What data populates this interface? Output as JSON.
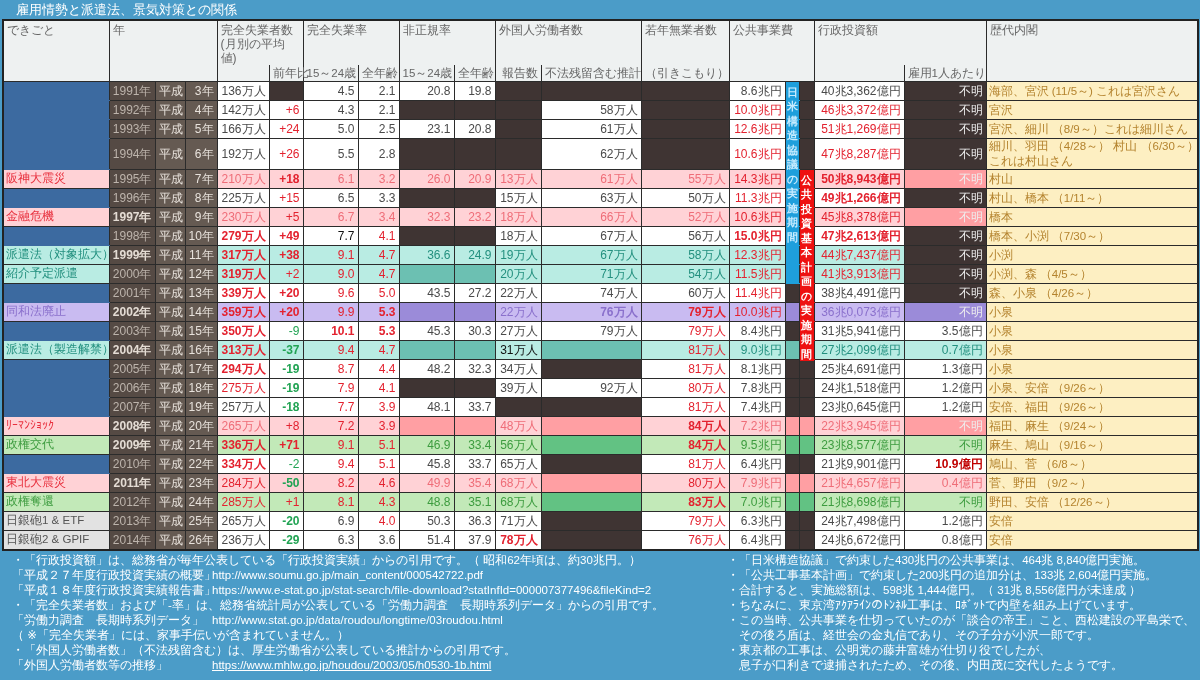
{
  "title": "雇用情勢と派遣法、景気対策との関係",
  "header": [
    {
      "title": "できごと"
    },
    {
      "title": "年"
    },
    {
      "title": "完全失業者数 (月別の平均値)",
      "subs": [
        "前年比"
      ]
    },
    {
      "title": "完全失業率",
      "subs": [
        "15～24歳",
        "全年齢"
      ]
    },
    {
      "title": "非正規率",
      "subs": [
        "15～24歳",
        "全年齢"
      ]
    },
    {
      "title": "外国人労働者数",
      "subs": [
        "報告数",
        "不法残留含む推計"
      ]
    },
    {
      "title": "若年無業者数",
      "subs": [
        "（引きこもり）"
      ]
    },
    {
      "title": "公共事業費"
    },
    {
      "title": "行政投資額",
      "subs": [
        "雇用1人あたり"
      ]
    },
    {
      "title": "歴代内閣"
    }
  ],
  "period_bars": [
    {
      "label": "日米構造協議の実施期間",
      "color": "#1e9fdc"
    },
    {
      "label": "公共投資基本計画の実施期間",
      "color": "#ee1111"
    }
  ],
  "rows": [
    {
      "year": "1991年",
      "era": "平成",
      "era_year": "3年",
      "highlight": false,
      "kind": "white",
      "periods": [
        true,
        false
      ],
      "cells": [
        {
          "text": "136万人",
          "kind": "plain"
        },
        {
          "kind": "dark"
        },
        {
          "text": "4.5",
          "kind": "plain"
        },
        {
          "text": "2.1",
          "kind": "plain"
        },
        {
          "text": "20.8",
          "kind": "plain"
        },
        {
          "text": "19.8",
          "kind": "plain"
        },
        {
          "kind": "dark"
        },
        {
          "kind": "dark"
        },
        {
          "kind": "dark"
        },
        {
          "text": "8.6兆円",
          "kind": "plain"
        },
        {
          "text": "40兆3,362億円",
          "kind": "plain"
        },
        {
          "text": "不明",
          "kind": "light-dark"
        }
      ],
      "cabinet": [
        "海部、宮沢 (11/5～) これは宮沢さん"
      ]
    },
    {
      "year": "1992年",
      "era": "平成",
      "era_year": "4年",
      "highlight": false,
      "kind": "white",
      "periods": [
        true,
        false
      ],
      "cells": [
        {
          "text": "142万人",
          "kind": "plain"
        },
        {
          "text": "+6",
          "kind": "red"
        },
        {
          "text": "4.3",
          "kind": "plain"
        },
        {
          "text": "2.1",
          "kind": "plain"
        },
        {
          "kind": "dark"
        },
        {
          "kind": "dark"
        },
        {
          "kind": "dark"
        },
        {
          "text": "58万人",
          "kind": "plain"
        },
        {
          "kind": "dark"
        },
        {
          "text": "10.0兆円",
          "kind": "red"
        },
        {
          "text": "46兆3,372億円",
          "kind": "red"
        },
        {
          "text": "不明",
          "kind": "light-dark"
        }
      ],
      "cabinet": [
        "宮沢"
      ]
    },
    {
      "year": "1993年",
      "era": "平成",
      "era_year": "5年",
      "highlight": false,
      "kind": "white",
      "periods": [
        true,
        false
      ],
      "cells": [
        {
          "text": "166万人",
          "kind": "plain"
        },
        {
          "text": "+24",
          "kind": "red"
        },
        {
          "text": "5.0",
          "kind": "plain"
        },
        {
          "text": "2.5",
          "kind": "plain"
        },
        {
          "text": "23.1",
          "kind": "plain"
        },
        {
          "text": "20.8",
          "kind": "plain"
        },
        {
          "kind": "dark"
        },
        {
          "text": "61万人",
          "kind": "plain"
        },
        {
          "kind": "dark"
        },
        {
          "text": "12.6兆円",
          "kind": "red"
        },
        {
          "text": "51兆1,269億円",
          "kind": "red"
        },
        {
          "text": "不明",
          "kind": "light-dark"
        }
      ],
      "cabinet": [
        "宮沢、細川 （8/9～）これは細川さん"
      ]
    },
    {
      "year": "1994年",
      "era": "平成",
      "era_year": "6年",
      "highlight": false,
      "kind": "white",
      "periods": [
        true,
        false
      ],
      "cells": [
        {
          "text": "192万人",
          "kind": "plain"
        },
        {
          "text": "+26",
          "kind": "red"
        },
        {
          "text": "5.5",
          "kind": "plain"
        },
        {
          "text": "2.8",
          "kind": "plain"
        },
        {
          "kind": "dark"
        },
        {
          "kind": "dark"
        },
        {
          "kind": "dark"
        },
        {
          "text": "62万人",
          "kind": "plain"
        },
        {
          "kind": "dark"
        },
        {
          "text": "10.6兆円",
          "kind": "red"
        },
        {
          "text": "47兆8,287億円",
          "kind": "red"
        },
        {
          "text": "不明",
          "kind": "light-dark"
        }
      ],
      "cabinet": [
        "細川、羽田 （4/28～） 村山 （6/30～）",
        "これは村山さん"
      ]
    },
    {
      "event": {
        "text": "阪神大震災",
        "kind": "pink"
      },
      "year": "1995年",
      "era": "平成",
      "era_year": "7年",
      "highlight": false,
      "kind": "pink",
      "periods": [
        true,
        true
      ],
      "cells": [
        {
          "text": "210万人",
          "kind": "plain"
        },
        {
          "text": "+18",
          "kind": "redb"
        },
        {
          "text": "6.1",
          "kind": "plain"
        },
        {
          "text": "3.2",
          "kind": "plain"
        },
        {
          "text": "26.0",
          "kind": "plain"
        },
        {
          "text": "20.9",
          "kind": "plain"
        },
        {
          "text": "13万人",
          "kind": "plain"
        },
        {
          "text": "61万人",
          "kind": "plain"
        },
        {
          "text": "55万人",
          "kind": "plain"
        },
        {
          "text": "14.3兆円",
          "kind": "red"
        },
        {
          "text": "50兆8,943億円",
          "kind": "redb"
        },
        {
          "text": "不明",
          "kind": "light-deep"
        }
      ],
      "cabinet": [
        "村山"
      ]
    },
    {
      "year": "1996年",
      "era": "平成",
      "era_year": "8年",
      "highlight": false,
      "kind": "white",
      "periods": [
        true,
        true
      ],
      "cells": [
        {
          "text": "225万人",
          "kind": "plain"
        },
        {
          "text": "+15",
          "kind": "red"
        },
        {
          "text": "6.5",
          "kind": "plain"
        },
        {
          "text": "3.3",
          "kind": "plain"
        },
        {
          "kind": "dark"
        },
        {
          "kind": "dark"
        },
        {
          "text": "15万人",
          "kind": "plain"
        },
        {
          "text": "63万人",
          "kind": "plain"
        },
        {
          "text": "50万人",
          "kind": "plain"
        },
        {
          "text": "11.3兆円",
          "kind": "red"
        },
        {
          "text": "49兆1,266億円",
          "kind": "redb"
        },
        {
          "text": "不明",
          "kind": "light-dark"
        }
      ],
      "cabinet": [
        "村山、橋本 （1/11～）"
      ]
    },
    {
      "event": {
        "text": "金融危機",
        "kind": "pink"
      },
      "year": "1997年",
      "era": "平成",
      "era_year": "9年",
      "highlight": true,
      "kind": "pink",
      "periods": [
        true,
        true
      ],
      "cells": [
        {
          "text": "230万人",
          "kind": "plain"
        },
        {
          "text": "+5",
          "kind": "red"
        },
        {
          "text": "6.7",
          "kind": "plain"
        },
        {
          "text": "3.4",
          "kind": "plain"
        },
        {
          "text": "32.3",
          "kind": "plain"
        },
        {
          "text": "23.2",
          "kind": "plain"
        },
        {
          "text": "18万人",
          "kind": "plain"
        },
        {
          "text": "66万人",
          "kind": "plain"
        },
        {
          "text": "52万人",
          "kind": "plain"
        },
        {
          "text": "10.6兆円",
          "kind": "red"
        },
        {
          "text": "45兆8,378億円",
          "kind": "red"
        },
        {
          "text": "不明",
          "kind": "light-deep"
        }
      ],
      "cabinet": [
        "橋本"
      ]
    },
    {
      "year": "1998年",
      "era": "平成",
      "era_year": "10年",
      "highlight": false,
      "kind": "white",
      "periods": [
        true,
        true
      ],
      "cells": [
        {
          "text": "279万人",
          "kind": "redb"
        },
        {
          "text": "+49",
          "kind": "redb"
        },
        {
          "text": "7.7",
          "kind": "black"
        },
        {
          "text": "4.1",
          "kind": "red"
        },
        {
          "kind": "dark"
        },
        {
          "kind": "dark"
        },
        {
          "text": "18万人",
          "kind": "plain"
        },
        {
          "text": "67万人",
          "kind": "plain"
        },
        {
          "text": "56万人",
          "kind": "plain"
        },
        {
          "text": "15.0兆円",
          "kind": "redb"
        },
        {
          "text": "47兆2,613億円",
          "kind": "redb"
        },
        {
          "text": "不明",
          "kind": "light-dark"
        }
      ],
      "cabinet": [
        "橋本、小渕 （7/30～）"
      ]
    },
    {
      "event": {
        "text": "派遣法（対象拡大）",
        "kind": "teal"
      },
      "year": "1999年",
      "era": "平成",
      "era_year": "11年",
      "highlight": true,
      "kind": "teal",
      "periods": [
        true,
        true
      ],
      "cells": [
        {
          "text": "317万人",
          "kind": "redb"
        },
        {
          "text": "+38",
          "kind": "redb"
        },
        {
          "text": "9.1",
          "kind": "red"
        },
        {
          "text": "4.7",
          "kind": "red"
        },
        {
          "text": "36.6",
          "kind": "plain"
        },
        {
          "text": "24.9",
          "kind": "plain"
        },
        {
          "text": "19万人",
          "kind": "plain"
        },
        {
          "text": "67万人",
          "kind": "plain"
        },
        {
          "text": "58万人",
          "kind": "plain"
        },
        {
          "text": "12.3兆円",
          "kind": "red"
        },
        {
          "text": "44兆7,437億円",
          "kind": "red"
        },
        {
          "text": "不明",
          "kind": "light-dark"
        }
      ],
      "cabinet": [
        "小渕"
      ]
    },
    {
      "event": {
        "text": "紹介予定派遣",
        "kind": "teal"
      },
      "year": "2000年",
      "era": "平成",
      "era_year": "12年",
      "highlight": false,
      "kind": "teal",
      "periods": [
        true,
        true
      ],
      "cells": [
        {
          "text": "319万人",
          "kind": "redb"
        },
        {
          "text": "+2",
          "kind": "red"
        },
        {
          "text": "9.0",
          "kind": "red"
        },
        {
          "text": "4.7",
          "kind": "red"
        },
        {
          "kind": "deep"
        },
        {
          "kind": "deep"
        },
        {
          "text": "20万人",
          "kind": "plain"
        },
        {
          "text": "71万人",
          "kind": "plain"
        },
        {
          "text": "54万人",
          "kind": "plain"
        },
        {
          "text": "11.5兆円",
          "kind": "red"
        },
        {
          "text": "41兆3,913億円",
          "kind": "red"
        },
        {
          "text": "不明",
          "kind": "light-dark"
        }
      ],
      "cabinet": [
        "小渕、森 （4/5～）"
      ]
    },
    {
      "year": "2001年",
      "era": "平成",
      "era_year": "13年",
      "highlight": false,
      "kind": "white",
      "periods": [
        false,
        true
      ],
      "cells": [
        {
          "text": "339万人",
          "kind": "redb"
        },
        {
          "text": "+20",
          "kind": "redb"
        },
        {
          "text": "9.6",
          "kind": "red"
        },
        {
          "text": "5.0",
          "kind": "red"
        },
        {
          "text": "43.5",
          "kind": "plain"
        },
        {
          "text": "27.2",
          "kind": "plain"
        },
        {
          "text": "22万人",
          "kind": "plain"
        },
        {
          "text": "74万人",
          "kind": "plain"
        },
        {
          "text": "60万人",
          "kind": "plain"
        },
        {
          "text": "11.4兆円",
          "kind": "red"
        },
        {
          "text": "38兆4,491億円",
          "kind": "plain"
        },
        {
          "text": "不明",
          "kind": "light-dark"
        }
      ],
      "cabinet": [
        "森、小泉 （4/26～）"
      ]
    },
    {
      "event": {
        "text": "同和法廃止",
        "kind": "purple"
      },
      "year": "2002年",
      "era": "平成",
      "era_year": "14年",
      "highlight": true,
      "kind": "purple",
      "periods": [
        false,
        true
      ],
      "cells": [
        {
          "text": "359万人",
          "kind": "redb"
        },
        {
          "text": "+20",
          "kind": "redb"
        },
        {
          "text": "9.9",
          "kind": "red"
        },
        {
          "text": "5.3",
          "kind": "redb"
        },
        {
          "kind": "deep"
        },
        {
          "kind": "deep"
        },
        {
          "text": "22万人",
          "kind": "plain"
        },
        {
          "text": "76万人",
          "kind": "plainb"
        },
        {
          "text": "79万人",
          "kind": "redb"
        },
        {
          "text": "10.0兆円",
          "kind": "red"
        },
        {
          "text": "36兆0,073億円",
          "kind": "plain"
        },
        {
          "text": "不明",
          "kind": "light-deep"
        }
      ],
      "cabinet": [
        "小泉"
      ]
    },
    {
      "year": "2003年",
      "era": "平成",
      "era_year": "15年",
      "highlight": false,
      "kind": "white",
      "periods": [
        false,
        true
      ],
      "cells": [
        {
          "text": "350万人",
          "kind": "redb"
        },
        {
          "text": "-9",
          "kind": "green"
        },
        {
          "text": "10.1",
          "kind": "redb"
        },
        {
          "text": "5.3",
          "kind": "redb"
        },
        {
          "text": "45.3",
          "kind": "plain"
        },
        {
          "text": "30.3",
          "kind": "plain"
        },
        {
          "text": "27万人",
          "kind": "plain"
        },
        {
          "text": "79万人",
          "kind": "plain"
        },
        {
          "text": "79万人",
          "kind": "red"
        },
        {
          "text": "8.4兆円",
          "kind": "plain"
        },
        {
          "text": "31兆5,941億円",
          "kind": "plain"
        },
        {
          "text": "3.5億円",
          "kind": "plain"
        }
      ],
      "cabinet": [
        "小泉"
      ]
    },
    {
      "event": {
        "text": "派遣法（製造解禁）",
        "kind": "teal"
      },
      "year": "2004年",
      "era": "平成",
      "era_year": "16年",
      "highlight": true,
      "kind": "teal",
      "periods": [
        false,
        true
      ],
      "cells": [
        {
          "text": "313万人",
          "kind": "redb"
        },
        {
          "text": "-37",
          "kind": "greenb"
        },
        {
          "text": "9.4",
          "kind": "red"
        },
        {
          "text": "4.7",
          "kind": "red"
        },
        {
          "kind": "deep"
        },
        {
          "kind": "deep"
        },
        {
          "text": "31万人",
          "kind": "black"
        },
        {
          "kind": "deep"
        },
        {
          "text": "81万人",
          "kind": "red"
        },
        {
          "text": "9.0兆円",
          "kind": "plain"
        },
        {
          "text": "27兆2,099億円",
          "kind": "plain"
        },
        {
          "text": "0.7億円",
          "kind": "plain"
        }
      ],
      "cabinet": [
        "小泉"
      ]
    },
    {
      "year": "2005年",
      "era": "平成",
      "era_year": "17年",
      "highlight": false,
      "kind": "white",
      "periods": [
        false,
        false
      ],
      "cells": [
        {
          "text": "294万人",
          "kind": "redb"
        },
        {
          "text": "-19",
          "kind": "greenb"
        },
        {
          "text": "8.7",
          "kind": "red"
        },
        {
          "text": "4.4",
          "kind": "red"
        },
        {
          "text": "48.2",
          "kind": "plain"
        },
        {
          "text": "32.3",
          "kind": "plain"
        },
        {
          "text": "34万人",
          "kind": "plain"
        },
        {
          "kind": "dark"
        },
        {
          "text": "81万人",
          "kind": "red"
        },
        {
          "text": "8.1兆円",
          "kind": "plain"
        },
        {
          "text": "25兆4,691億円",
          "kind": "plain"
        },
        {
          "text": "1.3億円",
          "kind": "plain"
        }
      ],
      "cabinet": [
        "小泉"
      ]
    },
    {
      "year": "2006年",
      "era": "平成",
      "era_year": "18年",
      "highlight": false,
      "kind": "white",
      "periods": [
        false,
        false
      ],
      "cells": [
        {
          "text": "275万人",
          "kind": "red"
        },
        {
          "text": "-19",
          "kind": "greenb"
        },
        {
          "text": "7.9",
          "kind": "red"
        },
        {
          "text": "4.1",
          "kind": "red"
        },
        {
          "kind": "dark"
        },
        {
          "kind": "dark"
        },
        {
          "text": "39万人",
          "kind": "plain"
        },
        {
          "text": "92万人",
          "kind": "plain"
        },
        {
          "text": "80万人",
          "kind": "red"
        },
        {
          "text": "7.8兆円",
          "kind": "plain"
        },
        {
          "text": "24兆1,518億円",
          "kind": "plain"
        },
        {
          "text": "1.2億円",
          "kind": "plain"
        }
      ],
      "cabinet": [
        "小泉、安倍 （9/26～）"
      ]
    },
    {
      "year": "2007年",
      "era": "平成",
      "era_year": "19年",
      "highlight": false,
      "kind": "white",
      "periods": [
        false,
        false
      ],
      "cells": [
        {
          "text": "257万人",
          "kind": "plain"
        },
        {
          "text": "-18",
          "kind": "greenb"
        },
        {
          "text": "7.7",
          "kind": "red"
        },
        {
          "text": "3.9",
          "kind": "red"
        },
        {
          "text": "48.1",
          "kind": "plain"
        },
        {
          "text": "33.7",
          "kind": "plain"
        },
        {
          "kind": "dark"
        },
        {
          "kind": "dark"
        },
        {
          "text": "81万人",
          "kind": "red"
        },
        {
          "text": "7.4兆円",
          "kind": "plain"
        },
        {
          "text": "23兆0,645億円",
          "kind": "plain"
        },
        {
          "text": "1.2億円",
          "kind": "plain"
        }
      ],
      "cabinet": [
        "安倍、福田 （9/26～）"
      ]
    },
    {
      "event": {
        "text": "ﾘｰﾏﾝｼｮｯｸ",
        "kind": "pink"
      },
      "year": "2008年",
      "era": "平成",
      "era_year": "20年",
      "highlight": true,
      "kind": "pink",
      "periods": [
        false,
        false
      ],
      "cells": [
        {
          "text": "265万人",
          "kind": "plain"
        },
        {
          "text": "+8",
          "kind": "red"
        },
        {
          "text": "7.2",
          "kind": "red"
        },
        {
          "text": "3.9",
          "kind": "red"
        },
        {
          "kind": "deep"
        },
        {
          "kind": "deep"
        },
        {
          "text": "48万人",
          "kind": "plain"
        },
        {
          "kind": "deep"
        },
        {
          "text": "84万人",
          "kind": "redb"
        },
        {
          "text": "7.2兆円",
          "kind": "plain"
        },
        {
          "text": "22兆3,945億円",
          "kind": "plain"
        },
        {
          "text": "不明",
          "kind": "light-deep"
        }
      ],
      "cabinet": [
        "福田、麻生 （9/24～）"
      ]
    },
    {
      "event": {
        "text": "政権交代",
        "kind": "green"
      },
      "year": "2009年",
      "era": "平成",
      "era_year": "21年",
      "highlight": true,
      "kind": "green",
      "periods": [
        false,
        false
      ],
      "cells": [
        {
          "text": "336万人",
          "kind": "redb"
        },
        {
          "text": "+71",
          "kind": "redb"
        },
        {
          "text": "9.1",
          "kind": "red"
        },
        {
          "text": "5.1",
          "kind": "red"
        },
        {
          "text": "46.9",
          "kind": "plain"
        },
        {
          "text": "33.4",
          "kind": "plain"
        },
        {
          "text": "56万人",
          "kind": "plain"
        },
        {
          "kind": "deep"
        },
        {
          "text": "84万人",
          "kind": "redb"
        },
        {
          "text": "9.5兆円",
          "kind": "plain"
        },
        {
          "text": "23兆8,577億円",
          "kind": "plain"
        },
        {
          "text": "不明",
          "kind": "plain"
        }
      ],
      "cabinet": [
        "麻生、鳩山 （9/16～）"
      ]
    },
    {
      "year": "2010年",
      "era": "平成",
      "era_year": "22年",
      "highlight": false,
      "kind": "white",
      "periods": [
        false,
        false
      ],
      "cells": [
        {
          "text": "334万人",
          "kind": "redb"
        },
        {
          "text": "-2",
          "kind": "green"
        },
        {
          "text": "9.4",
          "kind": "red"
        },
        {
          "text": "5.1",
          "kind": "red"
        },
        {
          "text": "45.8",
          "kind": "plain"
        },
        {
          "text": "33.7",
          "kind": "plain"
        },
        {
          "text": "65万人",
          "kind": "plain"
        },
        {
          "kind": "dark"
        },
        {
          "text": "81万人",
          "kind": "red"
        },
        {
          "text": "6.4兆円",
          "kind": "plain"
        },
        {
          "text": "21兆9,901億円",
          "kind": "plain"
        },
        {
          "text": "10.9億円",
          "kind": "darkredb"
        }
      ],
      "cabinet": [
        "鳩山、菅 （6/8～）"
      ]
    },
    {
      "event": {
        "text": "東北大震災",
        "kind": "pink"
      },
      "year": "2011年",
      "era": "平成",
      "era_year": "23年",
      "highlight": true,
      "kind": "pink",
      "periods": [
        false,
        false
      ],
      "cells": [
        {
          "text": "284万人",
          "kind": "red"
        },
        {
          "text": "-50",
          "kind": "greenb"
        },
        {
          "text": "8.2",
          "kind": "red"
        },
        {
          "text": "4.6",
          "kind": "red"
        },
        {
          "text": "49.9",
          "kind": "plain"
        },
        {
          "text": "35.4",
          "kind": "plain"
        },
        {
          "text": "68万人",
          "kind": "plain"
        },
        {
          "kind": "deep"
        },
        {
          "text": "80万人",
          "kind": "red"
        },
        {
          "text": "7.9兆円",
          "kind": "plain"
        },
        {
          "text": "21兆4,657億円",
          "kind": "plain"
        },
        {
          "text": "0.4億円",
          "kind": "plain"
        }
      ],
      "cabinet": [
        "菅、野田 （9/2～）"
      ]
    },
    {
      "event": {
        "text": "政権奪還",
        "kind": "green"
      },
      "year": "2012年",
      "era": "平成",
      "era_year": "24年",
      "highlight": false,
      "kind": "green",
      "periods": [
        false,
        false
      ],
      "cells": [
        {
          "text": "285万人",
          "kind": "red"
        },
        {
          "text": "+1",
          "kind": "red"
        },
        {
          "text": "8.1",
          "kind": "red"
        },
        {
          "text": "4.3",
          "kind": "red"
        },
        {
          "text": "48.8",
          "kind": "plain"
        },
        {
          "text": "35.1",
          "kind": "plain"
        },
        {
          "text": "68万人",
          "kind": "plain"
        },
        {
          "kind": "deep"
        },
        {
          "text": "83万人",
          "kind": "redb"
        },
        {
          "text": "7.0兆円",
          "kind": "plain"
        },
        {
          "text": "21兆8,698億円",
          "kind": "plain"
        },
        {
          "text": "不明",
          "kind": "plain"
        }
      ],
      "cabinet": [
        "野田、安倍 （12/26～）"
      ]
    },
    {
      "event": {
        "text": "日銀砲1 & ETF",
        "kind": "gray"
      },
      "year": "2013年",
      "era": "平成",
      "era_year": "25年",
      "highlight": false,
      "kind": "white",
      "periods": [
        false,
        false
      ],
      "cells": [
        {
          "text": "265万人",
          "kind": "plain"
        },
        {
          "text": "-20",
          "kind": "greenb"
        },
        {
          "text": "6.9",
          "kind": "plain"
        },
        {
          "text": "4.0",
          "kind": "red"
        },
        {
          "text": "50.3",
          "kind": "plain"
        },
        {
          "text": "36.3",
          "kind": "plain"
        },
        {
          "text": "71万人",
          "kind": "plain"
        },
        {
          "kind": "dark"
        },
        {
          "text": "79万人",
          "kind": "red"
        },
        {
          "text": "6.3兆円",
          "kind": "plain"
        },
        {
          "text": "24兆7,498億円",
          "kind": "plain"
        },
        {
          "text": "1.2億円",
          "kind": "plain"
        }
      ],
      "cabinet": [
        "安倍"
      ]
    },
    {
      "event": {
        "text": "日銀砲2 & GPIF",
        "kind": "gray"
      },
      "year": "2014年",
      "era": "平成",
      "era_year": "26年",
      "highlight": false,
      "kind": "white",
      "periods": [
        false,
        false
      ],
      "cells": [
        {
          "text": "236万人",
          "kind": "plain"
        },
        {
          "text": "-29",
          "kind": "greenb"
        },
        {
          "text": "6.3",
          "kind": "plain"
        },
        {
          "text": "3.6",
          "kind": "plain"
        },
        {
          "text": "51.4",
          "kind": "plain"
        },
        {
          "text": "37.9",
          "kind": "plain"
        },
        {
          "text": "78万人",
          "kind": "redb"
        },
        {
          "kind": "dark"
        },
        {
          "text": "76万人",
          "kind": "red"
        },
        {
          "text": "6.4兆円",
          "kind": "plain"
        },
        {
          "text": "24兆6,672億円",
          "kind": "plain"
        },
        {
          "text": "0.8億円",
          "kind": "plain"
        }
      ],
      "cabinet": [
        "安倍"
      ]
    }
  ],
  "notes_left": [
    {
      "kind": "note",
      "text": "・「行政投資額」は、総務省が毎年公表している「行政投資実績」からの引用です。（ 昭和62年頃は、約30兆円。）"
    },
    {
      "kind": "source",
      "label": "「平成２７年度行政投資実績の概要」",
      "url": "http://www.soumu.go.jp/main_content/000542722.pdf",
      "link": false
    },
    {
      "kind": "source",
      "label": "「平成１８年度行政投資実績報告書」",
      "url": "https://www.e-stat.go.jp/stat-search/file-download?statInfId=000007377496&fileKind=2",
      "link": false
    },
    {
      "kind": "note",
      "text": "・「完全失業者数」および「-率」は、総務省統計局が公表している「労働力調査　長期時系列データ」からの引用です。"
    },
    {
      "kind": "source",
      "label": "「労働力調査　長期時系列データ」",
      "url": "http://www.stat.go.jp/data/roudou/longtime/03roudou.html",
      "link": false
    },
    {
      "kind": "note",
      "text": "（ ※「完全失業者」には、家事手伝いが含まれていません。）"
    },
    {
      "kind": "note",
      "text": "・「外国人労働者数」（不法残留含む）は、厚生労働省が公表している推計からの引用です。"
    },
    {
      "kind": "source",
      "label": "「外国人労働者数等の推移」",
      "url": "https://www.mhlw.go.jp/houdou/2003/05/h0530-1b.html",
      "link": true
    }
  ],
  "notes_right": [
    {
      "lines": [
        "・「日米構造協議」で約束した430兆円の公共事業は、464兆 8,840億円実施。"
      ]
    },
    {
      "lines": [
        "・「公共工事基本計画」で約束した200兆円の追加分は、133兆 2,604億円実施。"
      ]
    },
    {
      "lines": [
        "・合計すると、実施総額は、598兆 1,444億円。（ 31兆 8,556億円が未達成 ）"
      ]
    },
    {
      "lines": [
        "・ちなみに、東京湾ｱｸｱﾗｲﾝのﾄﾝﾈﾙ工事は、ﾛﾎﾞｯﾄで内壁を組み上げています。"
      ]
    },
    {
      "lines": [
        "・この当時、公共事業を仕切っていたのが「談合の帝王」こと、西松建設の平島栄で、",
        "その後ろ盾は、経世会の金丸信であり、その子分が小沢一郎です。"
      ]
    },
    {
      "lines": [
        "・東京都の工事は、公明党の藤井富雄が仕切り役でしたが、",
        "息子が口利きで逮捕されたため、その後、内田茂に交代したようです。"
      ]
    }
  ]
}
